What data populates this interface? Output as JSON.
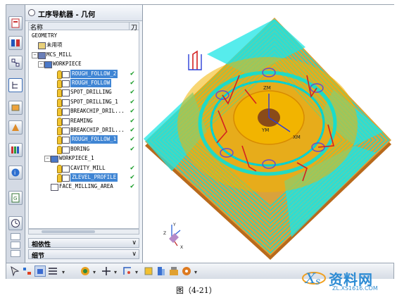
{
  "navigator": {
    "title": "工序导航器 - 几何",
    "col_name": "名称",
    "col_flag": "刀"
  },
  "tree": [
    {
      "label": "GEOMETRY",
      "icon": "none",
      "selected": false,
      "check": false
    },
    {
      "label": "未用项",
      "icon": "folder-icon",
      "selected": false,
      "check": false
    },
    {
      "label": "MCS_MILL",
      "icon": "mcs-icon",
      "selected": false,
      "check": false
    },
    {
      "label": "WORKPIECE",
      "icon": "workpiece-icon",
      "selected": false,
      "check": false
    },
    {
      "label": "ROUGH_FOLLOW_2",
      "icon": "operation-icon",
      "selected": true,
      "check": true
    },
    {
      "label": "ROUGH_FOLLOW",
      "icon": "operation-icon",
      "selected": true,
      "check": true
    },
    {
      "label": "SPOT_DRILLING",
      "icon": "drill-icon",
      "selected": false,
      "check": true
    },
    {
      "label": "SPOT_DRILLING_1",
      "icon": "drill-icon",
      "selected": false,
      "check": true
    },
    {
      "label": "BREAKCHIP_DRIL...",
      "icon": "drill-icon",
      "selected": false,
      "check": true
    },
    {
      "label": "REAMING",
      "icon": "drill-icon",
      "selected": false,
      "check": true
    },
    {
      "label": "BREAKCHIP_DRIL...",
      "icon": "drill-icon",
      "selected": false,
      "check": true
    },
    {
      "label": "ROUGH_FOLLOW_1",
      "icon": "operation-icon",
      "selected": true,
      "check": true
    },
    {
      "label": "BORING",
      "icon": "drill-icon",
      "selected": false,
      "check": true
    },
    {
      "label": "WORKPIECE_1",
      "icon": "workpiece-icon",
      "selected": false,
      "check": false
    },
    {
      "label": "CAVITY_MILL",
      "icon": "cavity-icon",
      "selected": false,
      "check": true
    },
    {
      "label": "ZLEVEL_PROFILE",
      "icon": "cavity-icon",
      "selected": true,
      "check": true
    },
    {
      "label": "FACE_MILLING_AREA",
      "icon": "face-mill-icon",
      "selected": false,
      "check": true
    }
  ],
  "panels": {
    "dependencies": "相依性",
    "details": "细节"
  },
  "viewport": {
    "axis_labels": {
      "zm": "ZM",
      "xm": "XM",
      "ym": "YM",
      "z": "Z",
      "y": "Y",
      "x": "X"
    }
  },
  "caption": "图（4-21）",
  "watermark": {
    "text": "资料网",
    "url": "ZL.XS1616.COM"
  },
  "colors": {
    "selection": "#3f85d4",
    "toolpath": "#00e0e0",
    "part": "#f2b400",
    "base": "#c8781e",
    "check": "#1a9e2a"
  }
}
